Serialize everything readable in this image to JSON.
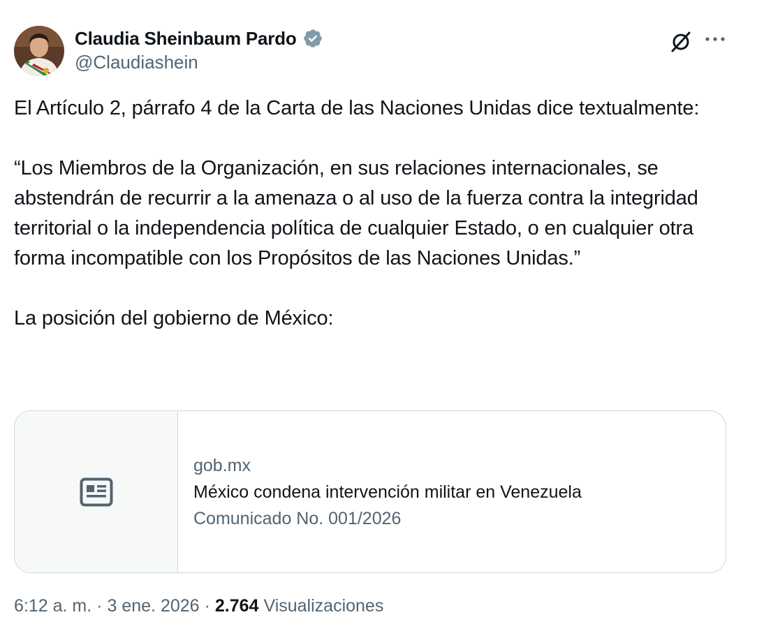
{
  "author": {
    "display_name": "Claudia Sheinbaum Pardo",
    "handle": "@Claudiashein",
    "verified_icon": "verified-badge-icon",
    "verified_color": "#829aab"
  },
  "actions": {
    "grok_icon": "grok-icon",
    "more_icon": "more-options-icon"
  },
  "tweet": {
    "paragraph_1": "El Artículo 2, párrafo 4 de la Carta de las Naciones Unidas dice textualmente:",
    "paragraph_2": "“Los Miembros de la Organización, en sus relaciones internacionales, se abstendrán de recurrir a la amenaza o al uso de la fuerza contra la integridad territorial o la independencia política de cualquier Estado, o en cualquier otra forma incompatible con los Propósitos de las Naciones Unidas.”",
    "paragraph_3": "La posición del gobierno de México:"
  },
  "link_card": {
    "icon": "article-icon",
    "domain": "gob.mx",
    "title": "México condena intervención militar en Venezuela",
    "description": "Comunicado No. 001/2026"
  },
  "meta": {
    "time": "6:12 a. m.",
    "separator": "·",
    "date": "3 ene. 2026",
    "views_count": "2.764",
    "views_label": "Visualizaciones"
  },
  "colors": {
    "text_primary": "#0f1419",
    "text_secondary": "#536471",
    "border": "#cfd9de",
    "card_thumb_bg": "#f7f9f9"
  }
}
